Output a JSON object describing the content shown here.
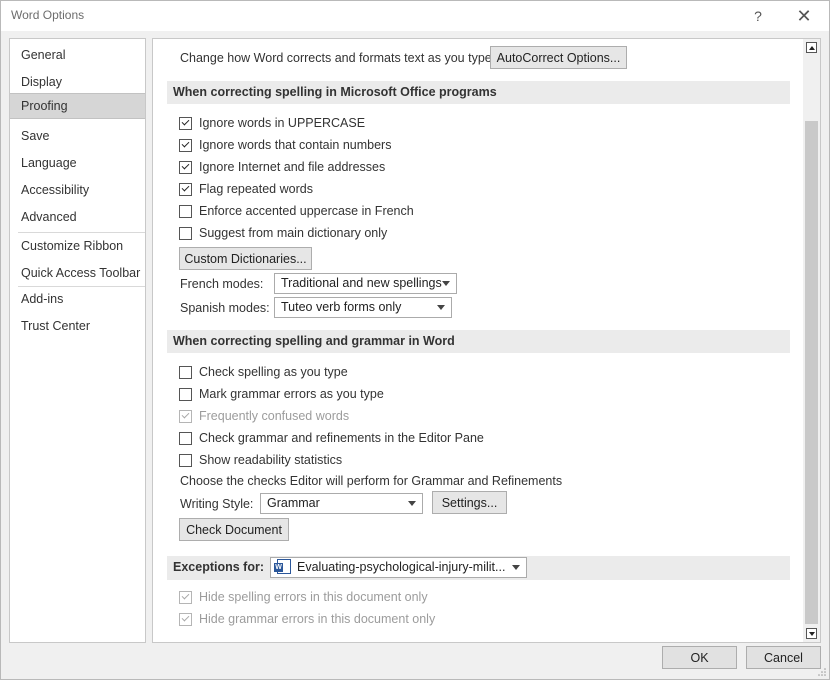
{
  "window": {
    "title": "Word Options",
    "help_glyph": "?",
    "close_glyph": "✕"
  },
  "sidebar": {
    "items": [
      {
        "label": "General"
      },
      {
        "label": "Display"
      },
      {
        "label": "Proofing",
        "selected": true
      },
      {
        "label": "Save"
      },
      {
        "label": "Language"
      },
      {
        "label": "Accessibility"
      },
      {
        "label": "Advanced"
      },
      {
        "label": "Customize Ribbon"
      },
      {
        "label": "Quick Access Toolbar"
      },
      {
        "label": "Add-ins"
      },
      {
        "label": "Trust Center"
      }
    ]
  },
  "autocorrect": {
    "description": "Change how Word corrects and formats text as you type:",
    "button_label": "AutoCorrect Options..."
  },
  "office_section": {
    "heading": "When correcting spelling in Microsoft Office programs",
    "checkboxes": [
      {
        "label": "Ignore words in UPPERCASE",
        "checked": true
      },
      {
        "label": "Ignore words that contain numbers",
        "checked": true
      },
      {
        "label": "Ignore Internet and file addresses",
        "checked": true
      },
      {
        "label": "Flag repeated words",
        "checked": true
      },
      {
        "label": "Enforce accented uppercase in French",
        "checked": false
      },
      {
        "label": "Suggest from main dictionary only",
        "checked": false
      }
    ],
    "custom_dictionaries_label": "Custom Dictionaries...",
    "french_modes_label": "French modes:",
    "french_modes_value": "Traditional and new spellings",
    "spanish_modes_label": "Spanish modes:",
    "spanish_modes_value": "Tuteo verb forms only"
  },
  "word_section": {
    "heading": "When correcting spelling and grammar in Word",
    "checkboxes": [
      {
        "label": "Check spelling as you type",
        "checked": false,
        "disabled": false
      },
      {
        "label": "Mark grammar errors as you type",
        "checked": false,
        "disabled": false
      },
      {
        "label": "Frequently confused words",
        "checked": true,
        "disabled": true
      },
      {
        "label": "Check grammar and refinements in the Editor Pane",
        "checked": false,
        "disabled": false
      },
      {
        "label": "Show readability statistics",
        "checked": false,
        "disabled": false
      }
    ],
    "choose_checks_text": "Choose the checks Editor will perform for Grammar and Refinements",
    "writing_style_label": "Writing Style:",
    "writing_style_value": "Grammar",
    "settings_label": "Settings...",
    "check_document_label": "Check Document"
  },
  "exceptions": {
    "label": "Exceptions for:",
    "document_name": "Evaluating-psychological-injury-milit...",
    "checkboxes": [
      {
        "label": "Hide spelling errors in this document only",
        "checked": true,
        "disabled": true
      },
      {
        "label": "Hide grammar errors in this document only",
        "checked": true,
        "disabled": true
      }
    ]
  },
  "footer": {
    "ok_label": "OK",
    "cancel_label": "Cancel"
  }
}
